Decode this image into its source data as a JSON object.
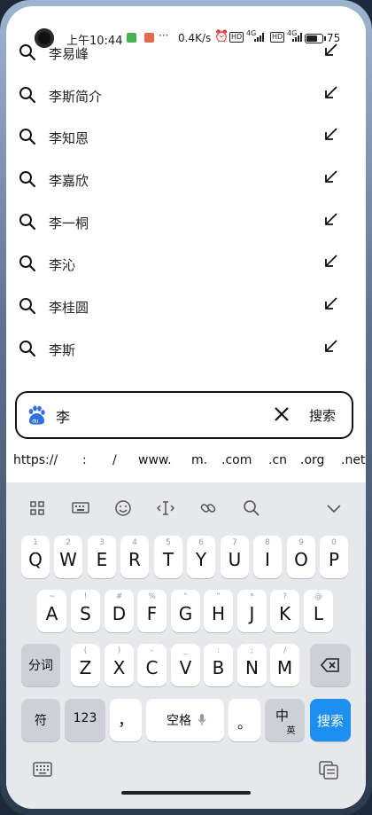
{
  "status_bar": {
    "time": "上午10:44",
    "dots": "···",
    "speed": "0.4K/s",
    "hd1": "HD",
    "hd2": "HD",
    "net1": "4G",
    "net2": "4G",
    "battery_percent": "75",
    "battery_level": 0.75
  },
  "suggestions": [
    {
      "text": "李易峰"
    },
    {
      "text": "李斯简介"
    },
    {
      "text": "李知恩"
    },
    {
      "text": "李嘉欣"
    },
    {
      "text": "李一桐"
    },
    {
      "text": "李沁"
    },
    {
      "text": "李桂圆"
    },
    {
      "text": "李斯"
    }
  ],
  "search": {
    "query": "李",
    "button_label": "搜索"
  },
  "quick_inputs": [
    "https://",
    ":",
    "/",
    "www.",
    "m.",
    ".com",
    ".cn",
    ".org",
    ".net"
  ],
  "keyboard": {
    "row1": [
      {
        "main": "Q",
        "sub": "1"
      },
      {
        "main": "W",
        "sub": "2"
      },
      {
        "main": "E",
        "sub": "3"
      },
      {
        "main": "R",
        "sub": "4"
      },
      {
        "main": "T",
        "sub": "5"
      },
      {
        "main": "Y",
        "sub": "6"
      },
      {
        "main": "U",
        "sub": "7"
      },
      {
        "main": "I",
        "sub": "8"
      },
      {
        "main": "O",
        "sub": "9"
      },
      {
        "main": "P",
        "sub": "0"
      }
    ],
    "row2": [
      {
        "main": "A",
        "sub": "~"
      },
      {
        "main": "S",
        "sub": "!"
      },
      {
        "main": "D",
        "sub": "#"
      },
      {
        "main": "F",
        "sub": "%"
      },
      {
        "main": "G",
        "sub": "“"
      },
      {
        "main": "H",
        "sub": "”"
      },
      {
        "main": "J",
        "sub": "*"
      },
      {
        "main": "K",
        "sub": "?"
      },
      {
        "main": "L",
        "sub": "@"
      }
    ],
    "row3": [
      {
        "main": "Z",
        "sub": "("
      },
      {
        "main": "X",
        "sub": ")"
      },
      {
        "main": "C",
        "sub": "-"
      },
      {
        "main": "V",
        "sub": "_"
      },
      {
        "main": "B",
        "sub": ":"
      },
      {
        "main": "N",
        "sub": ";"
      },
      {
        "main": "M",
        "sub": "/"
      }
    ],
    "fenci_label": "分词",
    "symbol_label": "符",
    "num_label": "123",
    "comma_label": "，",
    "space_label": "空格",
    "period_label": "。",
    "lang_main": "中",
    "lang_sub": "英",
    "search_label": "搜索"
  },
  "colors": {
    "accent": "#1c8ff0",
    "keyboard_bg": "#e7e8ec"
  }
}
